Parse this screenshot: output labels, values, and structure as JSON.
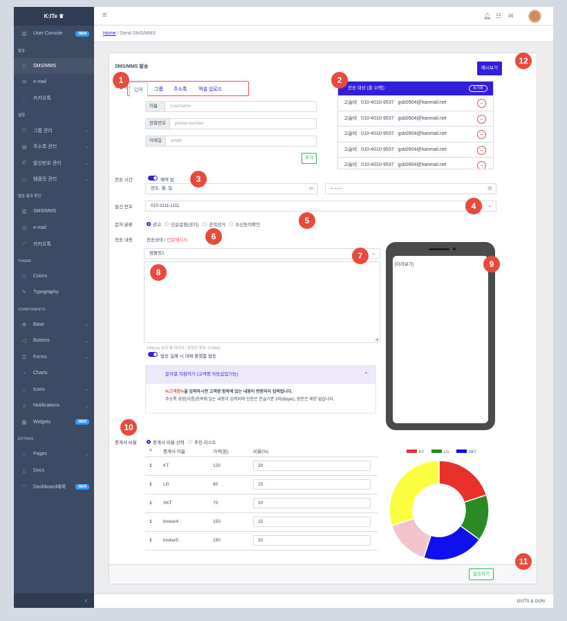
{
  "brand": "K:ITe",
  "sidebar": {
    "user_console": "User Console",
    "new_badge": "NEW",
    "section_send": "발송",
    "sms_mms": "SMS/MMS",
    "email": "e-mail",
    "kakao": "카카오톡",
    "section_settings": "설정",
    "group_mgmt": "그룹 관리",
    "addressbook_mgmt": "주소록 관리",
    "sender_mgmt": "발신번호 관리",
    "template_mgmt": "템플릿 관리",
    "section_result": "발송 결과 확인",
    "res_sms": "SMS/MMS",
    "res_email": "e-mail",
    "res_kakao": "카카오톡",
    "section_theme": "THEME",
    "colors": "Colors",
    "typography": "Typography",
    "section_components": "COMPONENTS",
    "base": "Base",
    "buttons": "Buttons",
    "forms": "Forms",
    "charts": "Charts",
    "icons": "Icons",
    "notifications": "Notifications",
    "widgets": "Widgets",
    "section_extras": "EXTRAS",
    "pages": "Pages",
    "docs": "Docs",
    "dashboard": "Dashboard예제",
    "minimizer": "‹"
  },
  "breadcrumb": {
    "home": "Home",
    "sep": " / ",
    "current": "Send SMS/MMS"
  },
  "footer": "GUTS & GUN",
  "card": {
    "title": "SMS/MMS 발송",
    "preview_button": "예시보기",
    "send_button": "발송하기"
  },
  "recipient": {
    "label": "수신자 선택",
    "tabs": [
      "입력",
      "그룹",
      "주소록",
      "엑셀 업로드"
    ],
    "name_prefix": "이름",
    "name_placeholder": "Username",
    "phone_prefix": "전화번호",
    "phone_placeholder": "phone number",
    "email_prefix": "이메일",
    "email_placeholder": "email",
    "add_button": "추가"
  },
  "targets": {
    "header": "전송 대상 (총 10명)",
    "reset": "초기화",
    "rows": [
      {
        "name": "고슬비",
        "phone": "010-4010-9537",
        "email": "gsb0904@hanmail.net"
      },
      {
        "name": "고슬비",
        "phone": "010-4010-9537",
        "email": "gsb0904@hanmail.net"
      },
      {
        "name": "고슬비",
        "phone": "010-4010-9537",
        "email": "gsb0904@hanmail.net"
      },
      {
        "name": "고슬비",
        "phone": "010-4010-9537",
        "email": "gsb0904@hanmail.net"
      },
      {
        "name": "고슬비",
        "phone": "010-4010-9537",
        "email": "gsb0904@hanmail.net"
      }
    ]
  },
  "schedule": {
    "label": "전송 시간",
    "toggle_label": "예약 발",
    "date_placeholder": "연도. 월. 일.",
    "time_placeholder": "-- --:--"
  },
  "sender": {
    "label": "발신 번호",
    "value": "010-1111-1111"
  },
  "category": {
    "label": "문자 분류",
    "options": [
      "광고",
      "단순알림(공지)",
      "공직선거",
      "수신동의확인"
    ],
    "selected": "광고"
  },
  "content": {
    "label": "전송 내용",
    "type_static": "전송상태 /",
    "type_link": "단문메시지",
    "template_value": "템플릿1",
    "hint": "140byte 초과 몇 이미지 / 동영상 첨부 시 MMS",
    "fallback_toggle": "발송 실패 시 대체 플랫폼 발송"
  },
  "placeholder_help": {
    "title": "문자열 치환하기 (고객명 자동삽입기능)",
    "line1_bold": "%고객명%",
    "line1": "을 입력하시면 고객명 항목에 있는 내용이 변환되어 입력됩니다.",
    "line2": "주소록 성명(이름)항목에 있는 내용이 입력되며 단문은 한글기준 3자(6byte), 장문은 제한 없습니다."
  },
  "preview": {
    "label": "[미리보기]"
  },
  "broker": {
    "label": "중계사 비율",
    "options": [
      "중계사 비율 선택",
      "추천 리스트"
    ],
    "selected": "중계사 비율 선택",
    "columns": [
      "#",
      "중계사 이름",
      "가격(원)",
      "비율(%)"
    ],
    "rows": [
      {
        "idx": "1",
        "name": "KT",
        "price": "120",
        "ratio": "20"
      },
      {
        "idx": "1",
        "name": "LG",
        "price": "80",
        "ratio": "15"
      },
      {
        "idx": "1",
        "name": "SKT",
        "price": "70",
        "ratio": "20"
      },
      {
        "idx": "1",
        "name": "broker4",
        "price": "150",
        "ratio": "15"
      },
      {
        "idx": "1",
        "name": "broker5",
        "price": "150",
        "ratio": "30"
      }
    ]
  },
  "chart_data": {
    "type": "pie",
    "legend": [
      "KT",
      "LG",
      "SKT"
    ],
    "categories": [
      "KT",
      "LG",
      "SKT",
      "broker4",
      "broker5"
    ],
    "values": [
      20,
      15,
      20,
      15,
      30
    ],
    "colors": [
      "#e8312a",
      "#2a8a23",
      "#0e10ee",
      "#f3c4cb",
      "#fefe40"
    ],
    "donut": true,
    "legend_position": "top"
  },
  "annotations": [
    "1",
    "2",
    "3",
    "4",
    "5",
    "6",
    "7",
    "8",
    "9",
    "10",
    "11",
    "12"
  ],
  "colors": {
    "primary": "#321fdb",
    "sidebar": "#3c4b64",
    "danger": "#e55353",
    "success": "#2eb85c",
    "annotation": "#e84a3c"
  }
}
